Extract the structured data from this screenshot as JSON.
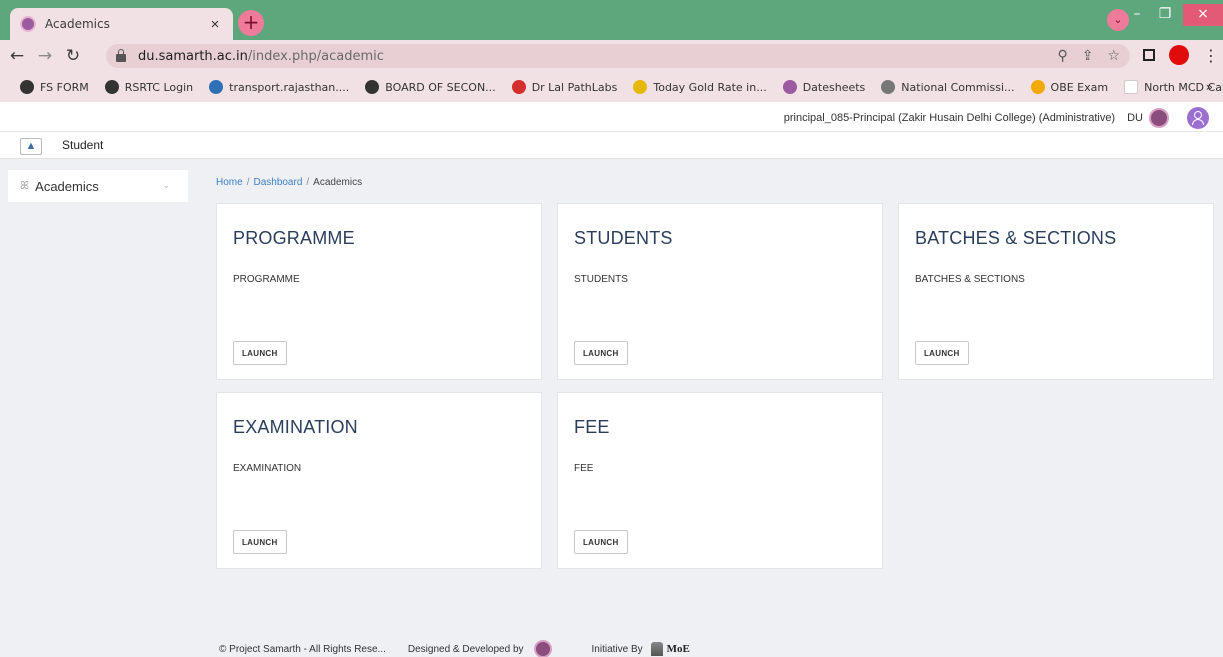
{
  "browser": {
    "tab_title": "Academics",
    "tab_close": "×",
    "new_tab": "+",
    "url_domain": "du.samarth.ac.in",
    "url_path": "/index.php/academic",
    "bookmarks": [
      {
        "label": "FS FORM",
        "icon": "globe-icon",
        "color": "#333333"
      },
      {
        "label": "RSRTC Login",
        "icon": "globe-icon",
        "color": "#333333"
      },
      {
        "label": "transport.rajasthan....",
        "icon": "bus-icon",
        "color": "#2f6fb5"
      },
      {
        "label": "BOARD OF SECON...",
        "icon": "globe-icon",
        "color": "#333333"
      },
      {
        "label": "Dr Lal PathLabs",
        "icon": "lab-icon",
        "color": "#d32f2f"
      },
      {
        "label": "Today Gold Rate in...",
        "icon": "gold-icon",
        "color": "#e6b800"
      },
      {
        "label": "Datesheets",
        "icon": "du-icon",
        "color": "#9c5aa0"
      },
      {
        "label": "National Commissi...",
        "icon": "emblem-icon",
        "color": "#777777"
      },
      {
        "label": "OBE Exam",
        "icon": "windows-icon",
        "color": "#f2a900"
      },
      {
        "label": "North MCD Call Ce...",
        "icon": "page-icon",
        "color": "#ffffff"
      }
    ],
    "bookmarks_more": "»"
  },
  "header": {
    "user_text": "principal_085-Principal (Zakir Husain Delhi College) (Administrative)",
    "org": "DU"
  },
  "module": {
    "label": "Student"
  },
  "sidebar": {
    "items": [
      {
        "label": "Academics"
      }
    ]
  },
  "breadcrumb": {
    "home": "Home",
    "sep": "/",
    "dashboard": "Dashboard",
    "current": "Academics"
  },
  "cards": [
    {
      "title": "PROGRAMME",
      "subtitle": "PROGRAMME",
      "button": "LAUNCH"
    },
    {
      "title": "STUDENTS",
      "subtitle": "STUDENTS",
      "button": "LAUNCH"
    },
    {
      "title": "BATCHES & SECTIONS",
      "subtitle": "BATCHES & SECTIONS",
      "button": "LAUNCH"
    },
    {
      "title": "EXAMINATION",
      "subtitle": "EXAMINATION",
      "button": "LAUNCH"
    },
    {
      "title": "FEE",
      "subtitle": "FEE",
      "button": "LAUNCH"
    }
  ],
  "footer": {
    "copyright": "© Project Samarth - All Rights Rese...",
    "designed": "Designed & Developed by",
    "initiative": "Initiative By",
    "moe": "MoE"
  },
  "colors": {
    "tabbar": "#5ea77d",
    "chrome": "#f2e1e4",
    "accent_link": "#3c7fc2",
    "card_title": "#2a3e5c",
    "page_bg": "#eef0f4"
  }
}
